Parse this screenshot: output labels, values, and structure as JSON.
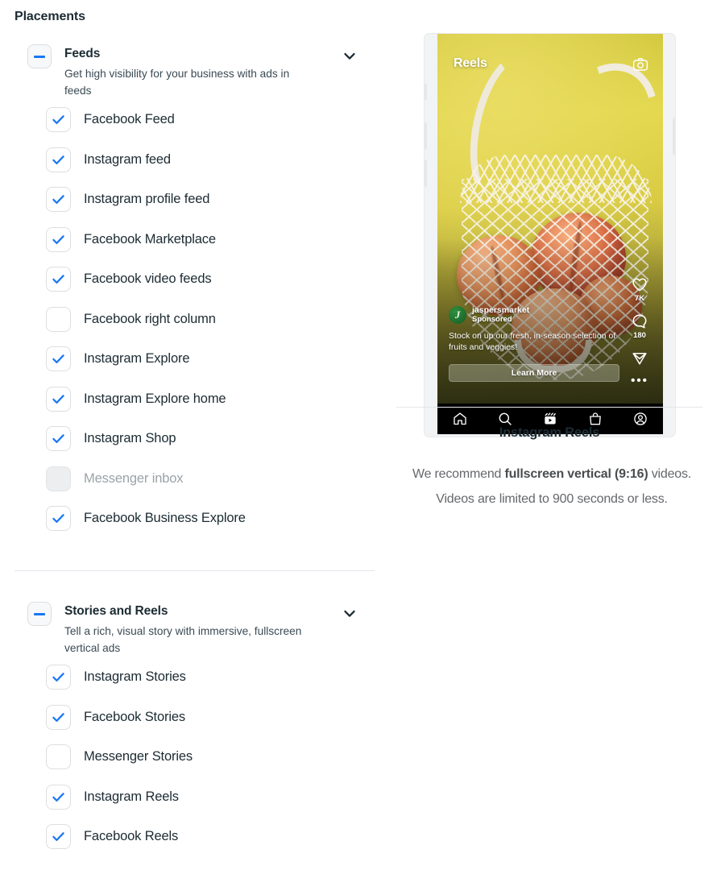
{
  "page": {
    "title": "Placements"
  },
  "sections": [
    {
      "id": "feeds",
      "title": "Feeds",
      "description": "Get high visibility for your business with ads in feeds",
      "toggle_icon": "minus-icon",
      "toggle_state": "indeterminate",
      "chevron_icon": "chevron-down-icon",
      "options": [
        {
          "label": "Facebook Feed",
          "checked": true,
          "disabled": false
        },
        {
          "label": "Instagram feed",
          "checked": true,
          "disabled": false
        },
        {
          "label": "Instagram profile feed",
          "checked": true,
          "disabled": false
        },
        {
          "label": "Facebook Marketplace",
          "checked": true,
          "disabled": false
        },
        {
          "label": "Facebook video feeds",
          "checked": true,
          "disabled": false
        },
        {
          "label": "Facebook right column",
          "checked": false,
          "disabled": false
        },
        {
          "label": "Instagram Explore",
          "checked": true,
          "disabled": false
        },
        {
          "label": "Instagram Explore home",
          "checked": true,
          "disabled": false
        },
        {
          "label": "Instagram Shop",
          "checked": true,
          "disabled": false
        },
        {
          "label": "Messenger inbox",
          "checked": false,
          "disabled": true
        },
        {
          "label": "Facebook Business Explore",
          "checked": true,
          "disabled": false
        }
      ]
    },
    {
      "id": "stories-and-reels",
      "title": "Stories and Reels",
      "description": "Tell a rich, visual story with immersive, fullscreen vertical ads",
      "toggle_icon": "minus-icon",
      "toggle_state": "indeterminate",
      "chevron_icon": "chevron-down-icon",
      "options": [
        {
          "label": "Instagram Stories",
          "checked": true,
          "disabled": false
        },
        {
          "label": "Facebook Stories",
          "checked": true,
          "disabled": false
        },
        {
          "label": "Messenger Stories",
          "checked": false,
          "disabled": false
        },
        {
          "label": "Instagram Reels",
          "checked": true,
          "disabled": false
        },
        {
          "label": "Facebook Reels",
          "checked": true,
          "disabled": false
        }
      ]
    }
  ],
  "preview": {
    "screen_label": "Reels",
    "camera_icon": "camera-icon",
    "ad": {
      "advertiser": "jaspersmarket",
      "sponsored_label": "Sponsored",
      "avatar_glyph": "J",
      "caption": "Stock on up our fresh, in-season selection of fruits and veggies!",
      "cta_label": "Learn More"
    },
    "actions": [
      {
        "icon": "heart-icon",
        "count": "7K"
      },
      {
        "icon": "comment-icon",
        "count": "180"
      },
      {
        "icon": "share-icon",
        "count": ""
      },
      {
        "icon": "more-options-icon",
        "count": ""
      }
    ],
    "tabbar": [
      {
        "icon": "home-icon"
      },
      {
        "icon": "search-icon"
      },
      {
        "icon": "reels-icon"
      },
      {
        "icon": "shop-icon"
      },
      {
        "icon": "profile-icon"
      }
    ],
    "title": "Instagram Reels",
    "description_parts": {
      "a": "We recommend ",
      "b": "fullscreen vertical (9:16)",
      "c": " videos. Videos are limited to 900 seconds or less."
    }
  },
  "colors": {
    "accent": "#1877f2",
    "text": "#1c2b33",
    "muted": "#65676b",
    "divider": "#e4e6eb"
  }
}
